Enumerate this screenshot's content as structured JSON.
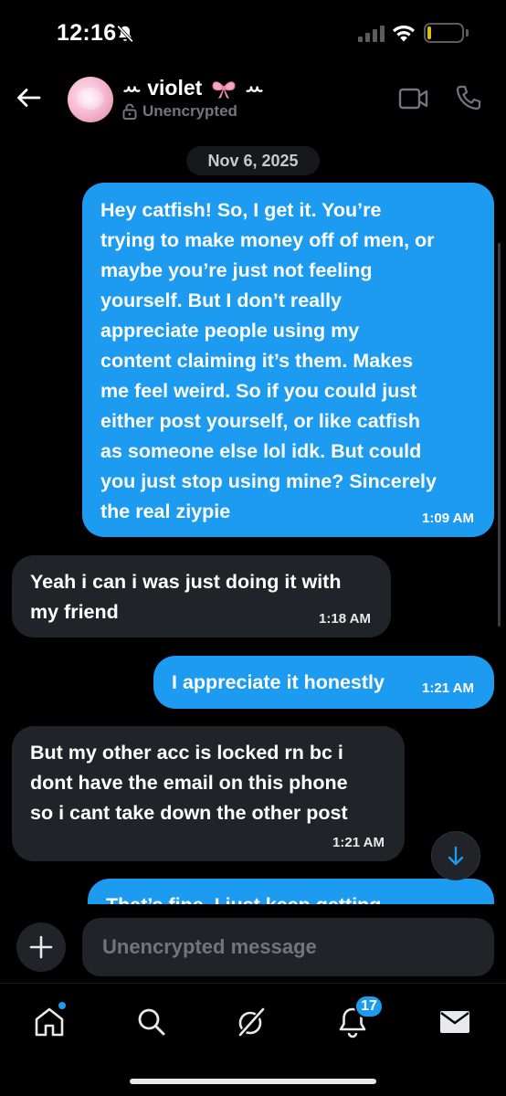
{
  "status_bar": {
    "time": "12:16",
    "battery": "7",
    "battery_level": 0.07,
    "icons": [
      "bell-off-icon",
      "signal-icon",
      "wifi-icon",
      "battery-icon"
    ]
  },
  "header": {
    "contact_name_prefix": "ꕀ violet",
    "contact_name_suffix": "ꕀ",
    "encryption_status": "Unencrypted",
    "icons": [
      "back-arrow-icon",
      "lock-icon",
      "video-call-icon",
      "phone-call-icon"
    ]
  },
  "conversation": {
    "date_divider": "Nov 6, 2025",
    "messages": [
      {
        "direction": "outgoing",
        "text": "Hey catfish! So, I get it. You’re\ntrying to make money off of men, or\nmaybe you’re just not feeling\nyourself. But I don’t really\nappreciate people using my\ncontent claiming it’s them. Makes\nme feel weird. So if you could just\neither post yourself, or like catfish\nas someone else lol idk. But could\nyou just stop using mine? Sincerely\nthe real ziypie",
        "time": "1:09 AM"
      },
      {
        "direction": "incoming",
        "text": "Yeah i can i was just doing it with\nmy friend",
        "time": "1:18 AM"
      },
      {
        "direction": "outgoing",
        "text": "I appreciate it honestly",
        "time": "1:21 AM"
      },
      {
        "direction": "incoming",
        "text": "But my other acc is locked rn bc i\ndont have the email on this phone\nso i cant take down the other post",
        "time": "1:21 AM"
      },
      {
        "direction": "outgoing",
        "text": "That’s fine. I just keep getting",
        "time": ""
      }
    ]
  },
  "composer": {
    "placeholder": "Unencrypted message",
    "value": ""
  },
  "bottom_nav": {
    "items": [
      "home-icon",
      "search-icon",
      "grok-icon",
      "notifications-icon",
      "messages-icon"
    ],
    "notifications_badge": "17"
  },
  "colors": {
    "accent": "#1d9bf0",
    "background": "#000000",
    "incoming_bubble": "#202327",
    "muted_text": "#71767b"
  }
}
